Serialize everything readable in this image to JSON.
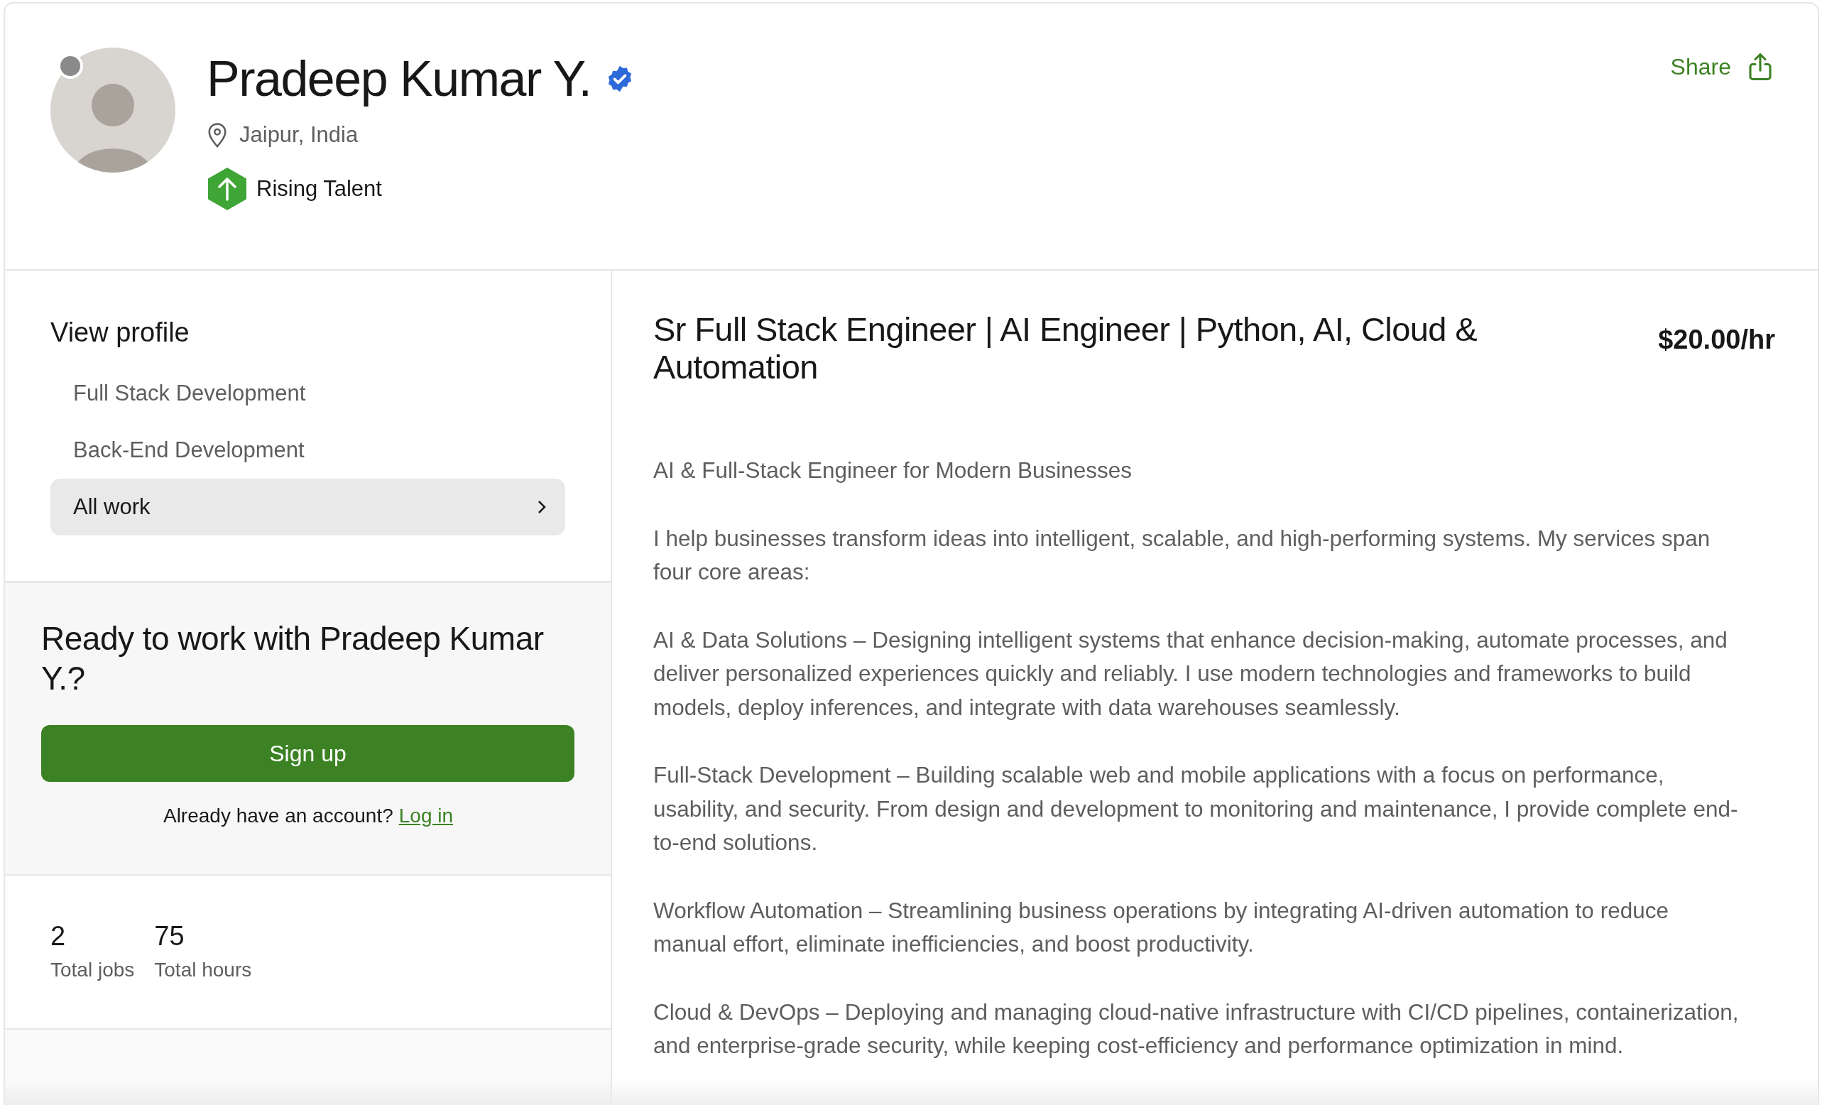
{
  "profile": {
    "name": "Pradeep Kumar Y.",
    "verified": true,
    "online": false,
    "location": "Jaipur, India",
    "badge": "Rising Talent",
    "share": "Share"
  },
  "sidebar": {
    "title": "View profile",
    "items": [
      {
        "label": "Full Stack Development",
        "selected": false
      },
      {
        "label": "Back-End Development",
        "selected": false
      },
      {
        "label": "All work",
        "selected": true
      }
    ]
  },
  "cta": {
    "heading": "Ready to work with Pradeep Kumar Y.?",
    "button": "Sign up",
    "prompt": "Already have an account?",
    "link": "Log in"
  },
  "stats": [
    {
      "value": "2",
      "label": "Total jobs"
    },
    {
      "value": "75",
      "label": "Total hours"
    }
  ],
  "overview": {
    "title": "Sr Full Stack Engineer | AI Engineer | Python, AI, Cloud & Automation",
    "rate": "$20.00/hr",
    "paragraphs": [
      "AI & Full-Stack Engineer for Modern Businesses",
      "I help businesses transform ideas into intelligent, scalable, and high-performing systems. My services span four core areas:",
      "AI & Data Solutions – Designing intelligent systems that enhance decision-making, automate processes, and deliver personalized experiences quickly and reliably. I use modern technologies and frameworks to build models, deploy inferences, and integrate with data warehouses seamlessly.",
      "Full-Stack Development – Building scalable web and mobile applications with a focus on performance, usability, and security. From design and development to monitoring and maintenance, I provide complete end-to-end solutions.",
      "Workflow Automation – Streamlining business operations by integrating AI-driven automation to reduce manual effort, eliminate inefficiencies, and boost productivity.",
      "Cloud & DevOps – Deploying and managing cloud-native infrastructure with CI/CD pipelines, containerization, and enterprise-grade security, while keeping cost-efficiency and performance optimization in mind."
    ]
  }
}
